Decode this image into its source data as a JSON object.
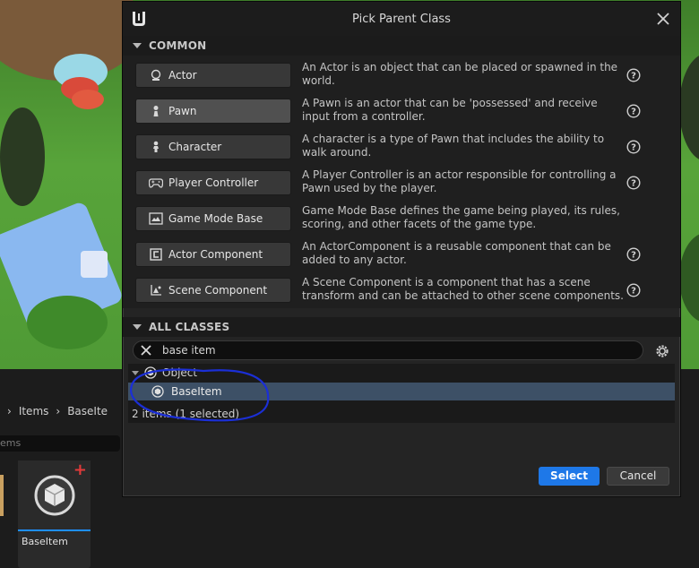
{
  "dialog": {
    "title": "Pick Parent Class",
    "common_header": "COMMON",
    "all_classes_header": "ALL CLASSES",
    "common_items": [
      {
        "label": "Actor",
        "description": "An Actor is an object that can be placed or spawned in the world.",
        "icon": "actor-icon",
        "selected": false
      },
      {
        "label": "Pawn",
        "description": "A Pawn is an actor that can be 'possessed' and receive input from a controller.",
        "icon": "pawn-icon",
        "selected": true
      },
      {
        "label": "Character",
        "description": "A character is a type of Pawn that includes the ability to walk around.",
        "icon": "character-icon",
        "selected": false
      },
      {
        "label": "Player Controller",
        "description": "A Player Controller is an actor responsible for controlling a Pawn used by the player.",
        "icon": "gamepad-icon",
        "selected": false
      },
      {
        "label": "Game Mode Base",
        "description": "Game Mode Base defines the game being played, its rules, scoring, and other facets of the game type.",
        "icon": "game-mode-icon",
        "selected": false
      },
      {
        "label": "Actor Component",
        "description": "An ActorComponent is a reusable component that can be added to any actor.",
        "icon": "actor-component-icon",
        "selected": false
      },
      {
        "label": "Scene Component",
        "description": "A Scene Component is a component that has a scene transform and can be attached to other scene components.",
        "icon": "scene-component-icon",
        "selected": false
      }
    ],
    "search": {
      "value": "base item"
    },
    "tree": [
      {
        "label": "Object",
        "depth": 0,
        "selected": false
      },
      {
        "label": "BaseItem",
        "depth": 1,
        "selected": true
      }
    ],
    "count_text": "2 items (1 selected)",
    "select_label": "Select",
    "cancel_label": "Cancel"
  },
  "background": {
    "breadcrumb": [
      "Items",
      "BaseIte"
    ],
    "search_fragment": "ems",
    "asset_name": "BaseItem"
  },
  "colors": {
    "accent": "#1e78e8",
    "selection": "#3d5066",
    "annotation": "#1b2fd6"
  }
}
